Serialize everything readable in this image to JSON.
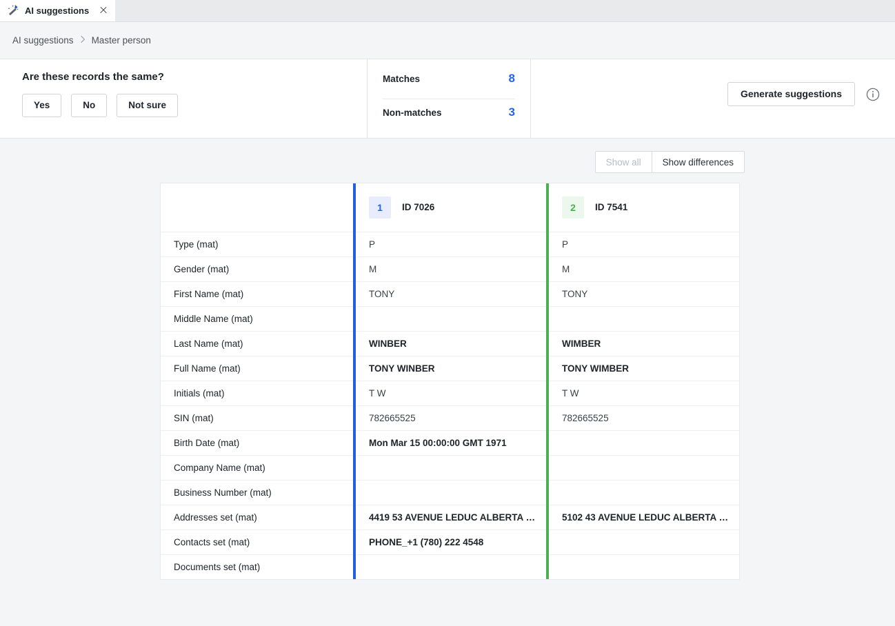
{
  "tab": {
    "icon": "magic-wand-icon",
    "label": "AI suggestions",
    "close": "×"
  },
  "breadcrumb": {
    "items": [
      "AI suggestions",
      "Master person"
    ],
    "separator": "›"
  },
  "action_header": {
    "question": "Are these records the same?",
    "buttons": [
      "Yes",
      "No",
      "Not sure"
    ],
    "stats": [
      {
        "label": "Matches",
        "value": "8"
      },
      {
        "label": "Non-matches",
        "value": "3"
      }
    ],
    "generate_label": "Generate suggestions",
    "info_icon": "info-circle-icon",
    "accent_color": "#2563eb"
  },
  "toolbar": {
    "show_all_label": "Show all",
    "show_differences_label": "Show differences",
    "active": "Show differences"
  },
  "comparison": {
    "columns": [
      {
        "badge": "1",
        "id_label": "ID 7026",
        "accent": "#1f5fe0"
      },
      {
        "badge": "2",
        "id_label": "ID 7541",
        "accent": "#4caf50"
      }
    ],
    "rows": [
      {
        "label": "Type (mat)",
        "v1": "P",
        "v2": "P",
        "diff1": false,
        "diff2": false
      },
      {
        "label": "Gender (mat)",
        "v1": "M",
        "v2": "M",
        "diff1": false,
        "diff2": false
      },
      {
        "label": "First Name (mat)",
        "v1": "TONY",
        "v2": "TONY",
        "diff1": false,
        "diff2": false
      },
      {
        "label": "Middle Name (mat)",
        "v1": "",
        "v2": "",
        "diff1": false,
        "diff2": false
      },
      {
        "label": "Last Name (mat)",
        "v1": "WINBER",
        "v2": "WIMBER",
        "diff1": true,
        "diff2": true
      },
      {
        "label": "Full Name (mat)",
        "v1": "TONY WINBER",
        "v2": "TONY WIMBER",
        "diff1": true,
        "diff2": true
      },
      {
        "label": "Initials (mat)",
        "v1": "T W",
        "v2": "T W",
        "diff1": false,
        "diff2": false
      },
      {
        "label": "SIN (mat)",
        "v1": "782665525",
        "v2": "782665525",
        "diff1": false,
        "diff2": false
      },
      {
        "label": "Birth Date (mat)",
        "v1": "Mon Mar 15 00:00:00 GMT 1971",
        "v2": "",
        "diff1": true,
        "diff2": false
      },
      {
        "label": "Company Name (mat)",
        "v1": "",
        "v2": "",
        "diff1": false,
        "diff2": false
      },
      {
        "label": "Business Number (mat)",
        "v1": "",
        "v2": "",
        "diff1": false,
        "diff2": false
      },
      {
        "label": "Addresses set (mat)",
        "v1": "4419 53 AVENUE LEDUC ALBERTA T9…",
        "v2": "5102 43 AVENUE LEDUC ALBERTA T9…",
        "diff1": true,
        "diff2": true
      },
      {
        "label": "Contacts set (mat)",
        "v1": "PHONE_+1 (780) 222 4548",
        "v2": "",
        "diff1": true,
        "diff2": false
      },
      {
        "label": "Documents set (mat)",
        "v1": "",
        "v2": "",
        "diff1": false,
        "diff2": false
      }
    ]
  }
}
